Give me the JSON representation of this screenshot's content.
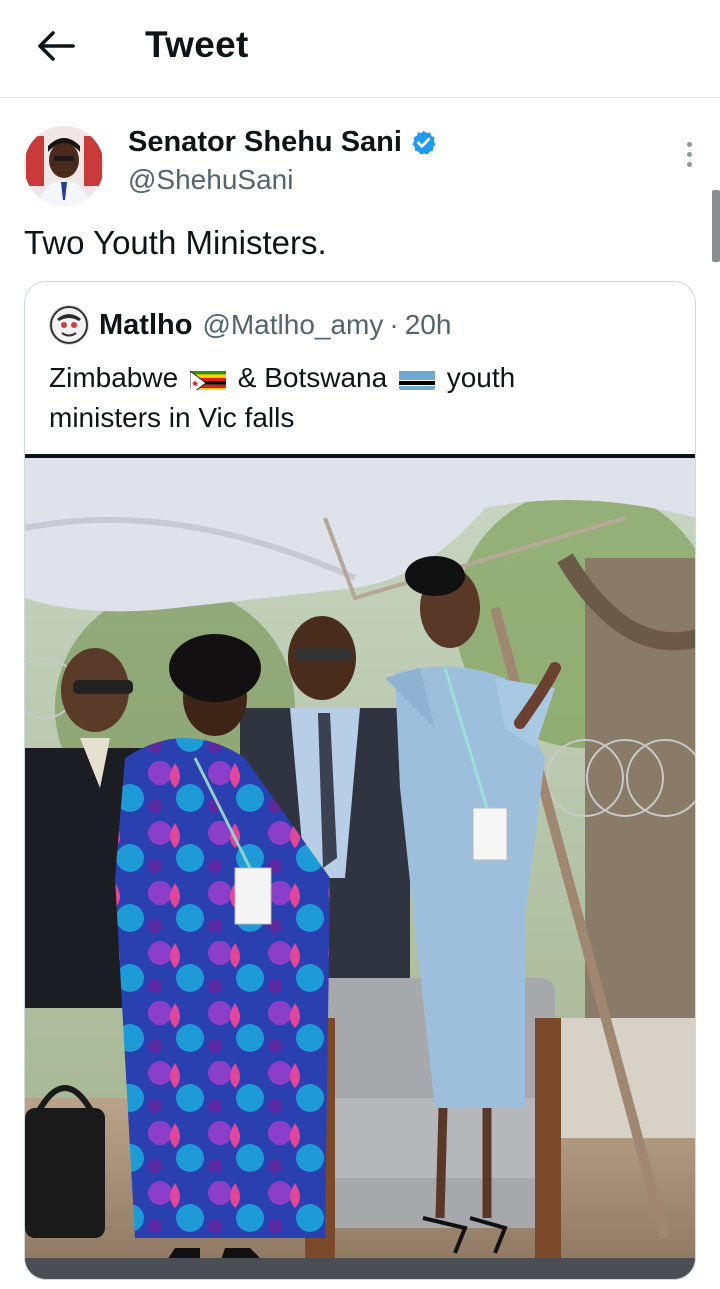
{
  "header": {
    "title": "Tweet",
    "back_icon": "arrow-left-icon"
  },
  "tweet": {
    "author": {
      "name": "Senator Shehu Sani",
      "handle": "@ShehuSani",
      "verified": true
    },
    "text": "Two Youth Ministers.",
    "more_icon": "more-vertical-icon"
  },
  "quote": {
    "author": {
      "name": "Matlho",
      "handle": "@Matlho_amy",
      "separator": "·",
      "time": "20h"
    },
    "text": {
      "part1": "Zimbabwe",
      "flag1": "zimbabwe-flag",
      "part2": "& Botswana",
      "flag2": "botswana-flag",
      "part3": "youth",
      "part4": "ministers in Vic falls"
    }
  },
  "colors": {
    "text_primary": "#0f1419",
    "text_secondary": "#536471",
    "verified_blue": "#1d9bf0",
    "border": "#cfd9de"
  }
}
